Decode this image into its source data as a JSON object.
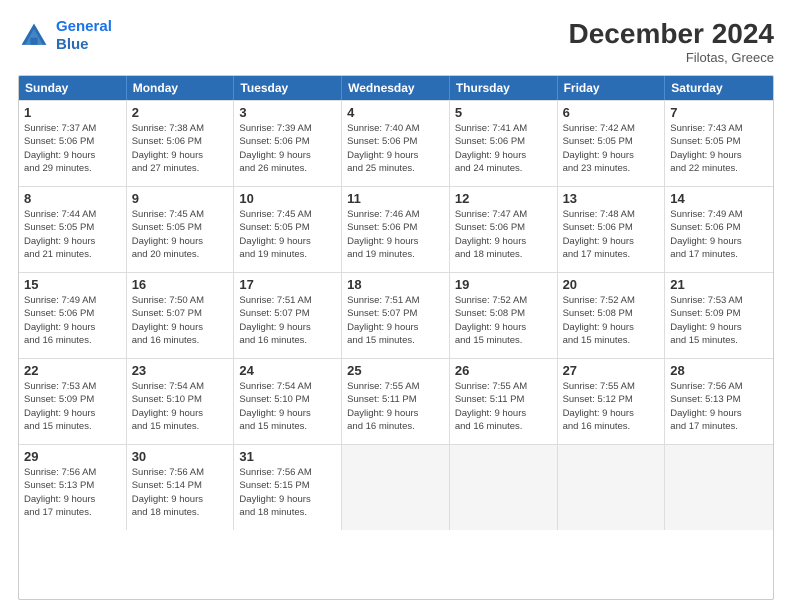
{
  "header": {
    "logo_line1": "General",
    "logo_line2": "Blue",
    "month_title": "December 2024",
    "location": "Filotas, Greece"
  },
  "weekdays": [
    "Sunday",
    "Monday",
    "Tuesday",
    "Wednesday",
    "Thursday",
    "Friday",
    "Saturday"
  ],
  "rows": [
    [
      {
        "day": "1",
        "sunrise": "7:37 AM",
        "sunset": "5:06 PM",
        "daylight": "9 hours and 29 minutes."
      },
      {
        "day": "2",
        "sunrise": "7:38 AM",
        "sunset": "5:06 PM",
        "daylight": "9 hours and 27 minutes."
      },
      {
        "day": "3",
        "sunrise": "7:39 AM",
        "sunset": "5:06 PM",
        "daylight": "9 hours and 26 minutes."
      },
      {
        "day": "4",
        "sunrise": "7:40 AM",
        "sunset": "5:06 PM",
        "daylight": "9 hours and 25 minutes."
      },
      {
        "day": "5",
        "sunrise": "7:41 AM",
        "sunset": "5:06 PM",
        "daylight": "9 hours and 24 minutes."
      },
      {
        "day": "6",
        "sunrise": "7:42 AM",
        "sunset": "5:05 PM",
        "daylight": "9 hours and 23 minutes."
      },
      {
        "day": "7",
        "sunrise": "7:43 AM",
        "sunset": "5:05 PM",
        "daylight": "9 hours and 22 minutes."
      }
    ],
    [
      {
        "day": "8",
        "sunrise": "7:44 AM",
        "sunset": "5:05 PM",
        "daylight": "9 hours and 21 minutes."
      },
      {
        "day": "9",
        "sunrise": "7:45 AM",
        "sunset": "5:05 PM",
        "daylight": "9 hours and 20 minutes."
      },
      {
        "day": "10",
        "sunrise": "7:45 AM",
        "sunset": "5:05 PM",
        "daylight": "9 hours and 19 minutes."
      },
      {
        "day": "11",
        "sunrise": "7:46 AM",
        "sunset": "5:06 PM",
        "daylight": "9 hours and 19 minutes."
      },
      {
        "day": "12",
        "sunrise": "7:47 AM",
        "sunset": "5:06 PM",
        "daylight": "9 hours and 18 minutes."
      },
      {
        "day": "13",
        "sunrise": "7:48 AM",
        "sunset": "5:06 PM",
        "daylight": "9 hours and 17 minutes."
      },
      {
        "day": "14",
        "sunrise": "7:49 AM",
        "sunset": "5:06 PM",
        "daylight": "9 hours and 17 minutes."
      }
    ],
    [
      {
        "day": "15",
        "sunrise": "7:49 AM",
        "sunset": "5:06 PM",
        "daylight": "9 hours and 16 minutes."
      },
      {
        "day": "16",
        "sunrise": "7:50 AM",
        "sunset": "5:07 PM",
        "daylight": "9 hours and 16 minutes."
      },
      {
        "day": "17",
        "sunrise": "7:51 AM",
        "sunset": "5:07 PM",
        "daylight": "9 hours and 16 minutes."
      },
      {
        "day": "18",
        "sunrise": "7:51 AM",
        "sunset": "5:07 PM",
        "daylight": "9 hours and 15 minutes."
      },
      {
        "day": "19",
        "sunrise": "7:52 AM",
        "sunset": "5:08 PM",
        "daylight": "9 hours and 15 minutes."
      },
      {
        "day": "20",
        "sunrise": "7:52 AM",
        "sunset": "5:08 PM",
        "daylight": "9 hours and 15 minutes."
      },
      {
        "day": "21",
        "sunrise": "7:53 AM",
        "sunset": "5:09 PM",
        "daylight": "9 hours and 15 minutes."
      }
    ],
    [
      {
        "day": "22",
        "sunrise": "7:53 AM",
        "sunset": "5:09 PM",
        "daylight": "9 hours and 15 minutes."
      },
      {
        "day": "23",
        "sunrise": "7:54 AM",
        "sunset": "5:10 PM",
        "daylight": "9 hours and 15 minutes."
      },
      {
        "day": "24",
        "sunrise": "7:54 AM",
        "sunset": "5:10 PM",
        "daylight": "9 hours and 15 minutes."
      },
      {
        "day": "25",
        "sunrise": "7:55 AM",
        "sunset": "5:11 PM",
        "daylight": "9 hours and 16 minutes."
      },
      {
        "day": "26",
        "sunrise": "7:55 AM",
        "sunset": "5:11 PM",
        "daylight": "9 hours and 16 minutes."
      },
      {
        "day": "27",
        "sunrise": "7:55 AM",
        "sunset": "5:12 PM",
        "daylight": "9 hours and 16 minutes."
      },
      {
        "day": "28",
        "sunrise": "7:56 AM",
        "sunset": "5:13 PM",
        "daylight": "9 hours and 17 minutes."
      }
    ],
    [
      {
        "day": "29",
        "sunrise": "7:56 AM",
        "sunset": "5:13 PM",
        "daylight": "9 hours and 17 minutes."
      },
      {
        "day": "30",
        "sunrise": "7:56 AM",
        "sunset": "5:14 PM",
        "daylight": "9 hours and 18 minutes."
      },
      {
        "day": "31",
        "sunrise": "7:56 AM",
        "sunset": "5:15 PM",
        "daylight": "9 hours and 18 minutes."
      },
      null,
      null,
      null,
      null
    ]
  ]
}
